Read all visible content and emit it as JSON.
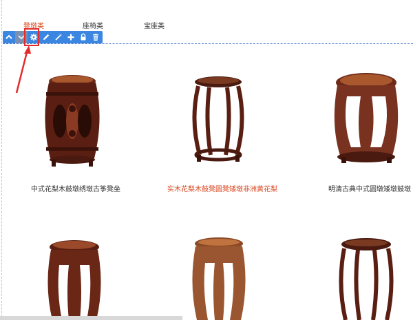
{
  "tabs": [
    {
      "label": "凳墩类",
      "active": true
    },
    {
      "label": "座椅类",
      "active": false
    },
    {
      "label": "宝座类",
      "active": false
    }
  ],
  "toolbar": {
    "buttons": [
      {
        "icon": "chevron-up-icon",
        "state": "normal"
      },
      {
        "icon": "chevron-down-icon",
        "state": "disabled"
      },
      {
        "icon": "gear-icon",
        "state": "highlighted"
      },
      {
        "icon": "pencil-icon",
        "state": "normal"
      },
      {
        "icon": "magic-wand-icon",
        "state": "normal"
      },
      {
        "icon": "plus-icon",
        "state": "normal"
      },
      {
        "icon": "lock-icon",
        "state": "normal"
      },
      {
        "icon": "trash-icon",
        "state": "normal"
      }
    ],
    "color": "#3b86e0",
    "highlight_color": "#e52a2a"
  },
  "products": [
    {
      "caption": "中式花梨木鼓墩绣墩古筝凳坐",
      "active": false
    },
    {
      "caption": "实木花梨木鼓凳圆凳矮墩非洲黄花梨",
      "active": true
    },
    {
      "caption": "明清古典中式圆墩矮墩鼓墩",
      "active": false
    },
    {
      "caption": "",
      "active": false
    },
    {
      "caption": "",
      "active": false
    },
    {
      "caption": "",
      "active": false
    }
  ],
  "colors": {
    "accent": "#d9461f",
    "wood_dark": "#4a1a10",
    "wood_mid": "#6e2a18",
    "wood_light": "#a9582e"
  }
}
